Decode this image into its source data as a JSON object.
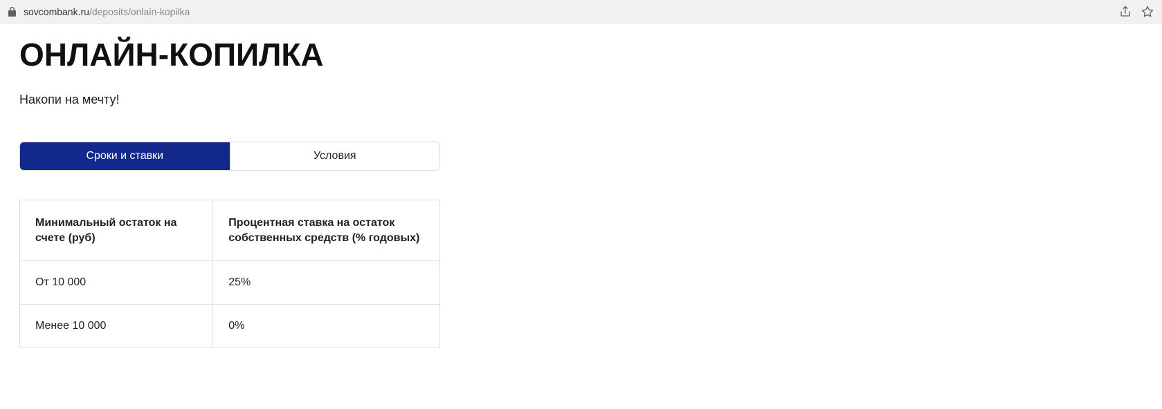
{
  "address": {
    "domain": "sovcombank.ru",
    "path": "/deposits/onlain-kopilka"
  },
  "header": {
    "title": "ОНЛАЙН-КОПИЛКА",
    "subtitle": "Накопи на мечту!"
  },
  "tabs": [
    {
      "label": "Сроки и ставки",
      "active": true
    },
    {
      "label": "Условия",
      "active": false
    }
  ],
  "table": {
    "headers": [
      "Минимальный остаток на счете (руб)",
      "Процентная ставка на остаток собственных средств (% годовых)"
    ],
    "rows": [
      [
        "От 10 000",
        "25%"
      ],
      [
        "Менее 10 000",
        "0%"
      ]
    ]
  }
}
